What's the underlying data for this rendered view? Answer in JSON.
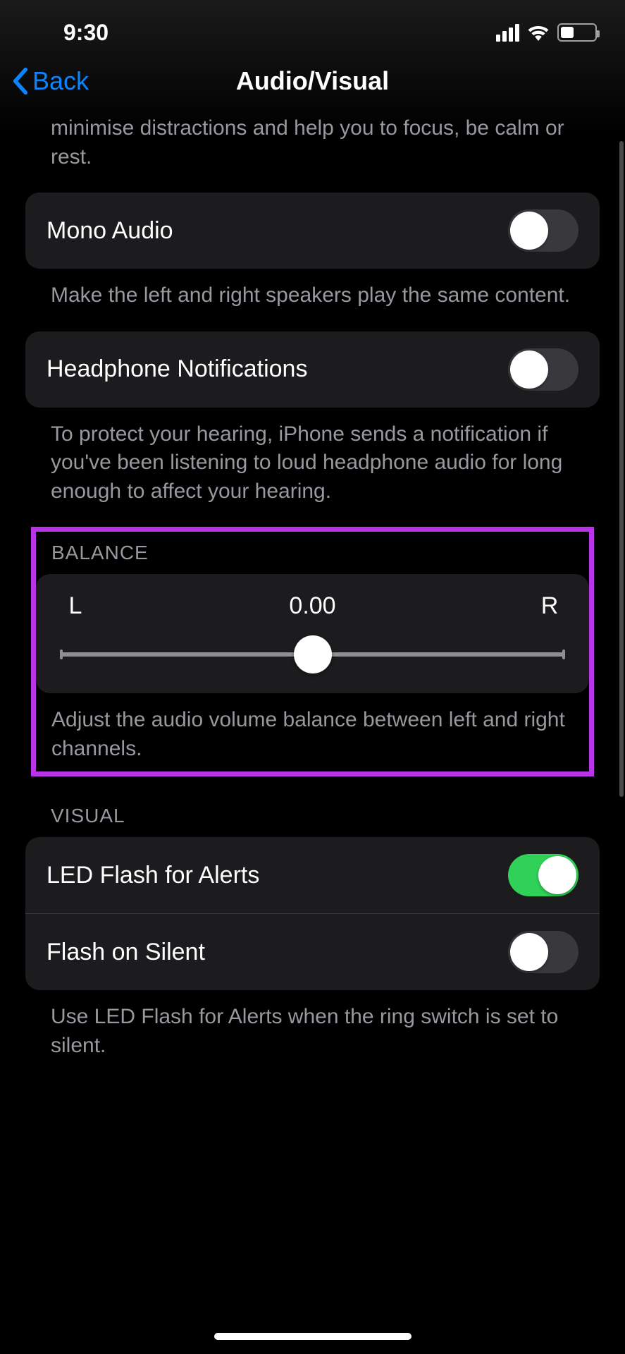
{
  "status": {
    "time": "9:30"
  },
  "nav": {
    "back": "Back",
    "title": "Audio/Visual"
  },
  "top_partial_desc": "minimise distractions and help you to focus, be calm or rest.",
  "mono": {
    "label": "Mono Audio",
    "on": false,
    "desc": "Make the left and right speakers play the same content."
  },
  "headphone": {
    "label": "Headphone Notifications",
    "on": false,
    "desc": "To protect your hearing, iPhone sends a notification if you've been listening to loud headphone audio for long enough to affect your hearing."
  },
  "balance": {
    "header": "BALANCE",
    "left": "L",
    "right": "R",
    "value": "0.00",
    "desc": "Adjust the audio volume balance between left and right channels."
  },
  "visual": {
    "header": "VISUAL",
    "led": {
      "label": "LED Flash for Alerts",
      "on": true
    },
    "flash_silent": {
      "label": "Flash on Silent",
      "on": false
    },
    "desc": "Use LED Flash for Alerts when the ring switch is set to silent."
  }
}
